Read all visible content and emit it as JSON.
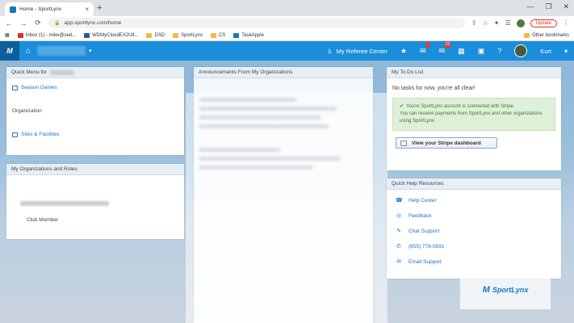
{
  "browser": {
    "tab_title": "Home - SportLynx",
    "tab_close": "×",
    "new_tab": "+",
    "window_controls": [
      "—",
      "❐",
      "✕"
    ],
    "url": "app.sportlynx.com/home",
    "update_label": "Update",
    "nav": {
      "back": "←",
      "forward": "→",
      "reload": "⟳"
    },
    "bookmarks": [
      {
        "label": "Inbox (1) - mike@sed...",
        "icon": "gmail-icon"
      },
      {
        "label": "WDMyCloudEX2Ult...",
        "icon": "ms-icon"
      },
      {
        "label": "DSD",
        "icon": "folder-icon"
      },
      {
        "label": "SportLynx",
        "icon": "folder-icon"
      },
      {
        "label": "CS",
        "icon": "folder-icon"
      },
      {
        "label": "TaskApple",
        "icon": "folder-icon"
      }
    ],
    "other_bookmarks": "Other bookmarks"
  },
  "appnav": {
    "logo_text": "M",
    "referee_center": "My Referee Center",
    "mail_badge": "23",
    "user_name": "Kurt",
    "caret": "▾"
  },
  "quick_menu": {
    "header": "Quick Menu for",
    "season_games": "Season Games",
    "organization_label": "Organization",
    "sites_facilities": "Sites & Facilities"
  },
  "my_orgs": {
    "header": "My Organizations and Roles",
    "role": "Club Member"
  },
  "announcements": {
    "header": "Announcements From My Organizations"
  },
  "todo": {
    "header": "My To Do List",
    "empty_text": "No tasks for now, you're all clear!",
    "alert_line1": "You're SportLynx account is connected with Stripe.",
    "alert_line2": "You can receive payments from SportLynx and other organizations using SportLynx.",
    "stripe_button": "View your Stripe dashboard"
  },
  "help": {
    "header": "Quick Help Resources",
    "items": [
      {
        "label": "Help Center",
        "icon": "help-center-icon"
      },
      {
        "label": "Feedback",
        "icon": "feedback-icon"
      },
      {
        "label": "Chat Support",
        "icon": "chat-icon"
      },
      {
        "label": "(855) 778-5691",
        "icon": "phone-icon"
      },
      {
        "label": "Email Support",
        "icon": "email-icon"
      }
    ]
  },
  "brand": {
    "text": "SportLynx"
  },
  "colors": {
    "nav_blue": "#1a8ddb",
    "link_blue": "#1a73c9",
    "success_bg": "#dff0d8",
    "badge_red": "#e23a3a"
  }
}
